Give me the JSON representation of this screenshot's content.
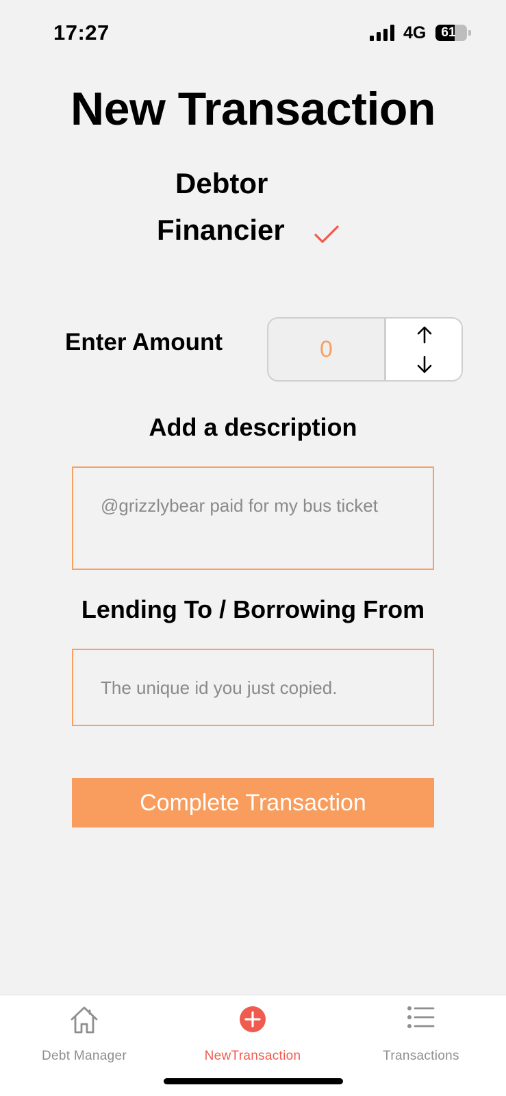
{
  "status_bar": {
    "time": "17:27",
    "network": "4G",
    "battery": "61",
    "battery_level": 0.61
  },
  "header": {
    "title": "New Transaction"
  },
  "roles": {
    "debtor_label": "Debtor",
    "financier_label": "Financier",
    "selected": "Financier"
  },
  "amount": {
    "label": "Enter Amount",
    "value": "0"
  },
  "description": {
    "label": "Add a description",
    "placeholder": "@grizzlybear paid for my bus ticket"
  },
  "counterparty": {
    "label": "Lending To / Borrowing From",
    "placeholder": "The unique id you just copied."
  },
  "actions": {
    "complete_label": "Complete Transaction"
  },
  "tab_bar": {
    "tabs": [
      {
        "label": "Debt Manager",
        "icon": "home-icon"
      },
      {
        "label": "NewTransaction",
        "icon": "plus-circle-icon",
        "active": true
      },
      {
        "label": "Transactions",
        "icon": "list-icon"
      }
    ]
  },
  "colors": {
    "accent": "#f89d5e",
    "active_tab": "#ef5b4e",
    "check": "#ef5b4e",
    "placeholder": "#8a8a8a"
  }
}
